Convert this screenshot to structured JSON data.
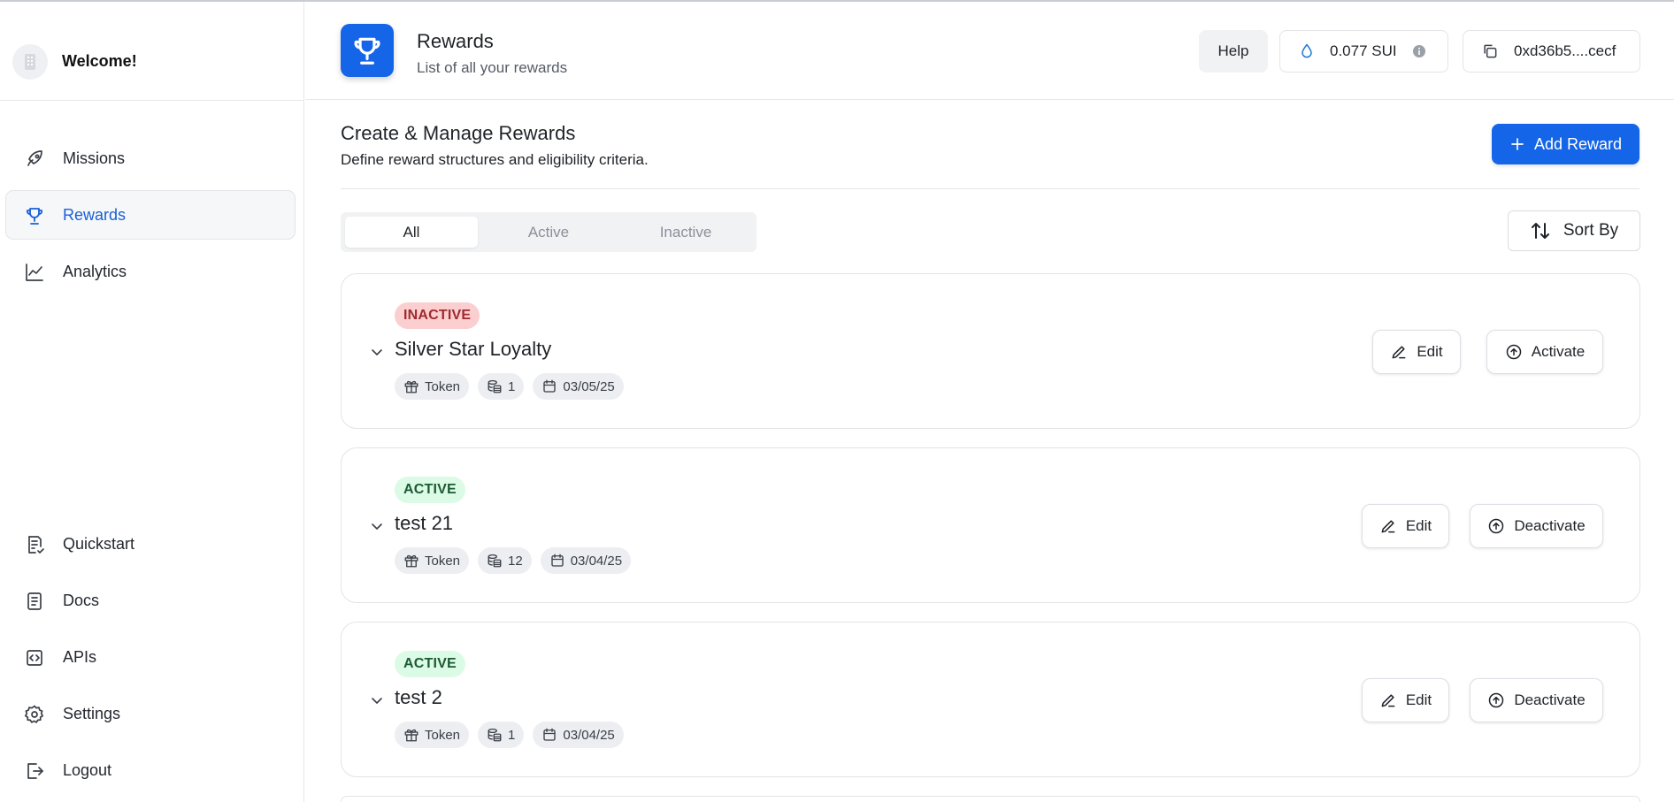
{
  "sidebar": {
    "brand_title": "Welcome!",
    "nav_top": [
      {
        "label": "Missions",
        "icon": "rocket-icon"
      },
      {
        "label": "Rewards",
        "icon": "trophy-icon",
        "active": true
      },
      {
        "label": "Analytics",
        "icon": "chart-line-icon"
      }
    ],
    "nav_bottom": [
      {
        "label": "Quickstart",
        "icon": "quickstart-icon"
      },
      {
        "label": "Docs",
        "icon": "docs-icon"
      },
      {
        "label": "APIs",
        "icon": "code-icon"
      },
      {
        "label": "Settings",
        "icon": "gear-icon"
      },
      {
        "label": "Logout",
        "icon": "logout-icon"
      }
    ]
  },
  "header": {
    "title": "Rewards",
    "subtitle": "List of all your rewards",
    "help_label": "Help",
    "balance": "0.077 SUI",
    "wallet": "0xd36b5....cecf"
  },
  "main": {
    "section_title": "Create & Manage Rewards",
    "section_subtitle": "Define reward structures and eligibility criteria.",
    "add_button": "Add Reward",
    "tabs": [
      {
        "label": "All",
        "selected": true
      },
      {
        "label": "Active"
      },
      {
        "label": "Inactive"
      }
    ],
    "sort_label": "Sort By",
    "rewards": [
      {
        "status": "INACTIVE",
        "name": "Silver Star Loyalty",
        "type": "Token",
        "count": "1",
        "date": "03/05/25",
        "edit": "Edit",
        "action": "Activate"
      },
      {
        "status": "ACTIVE",
        "name": "test 21",
        "type": "Token",
        "count": "12",
        "date": "03/04/25",
        "edit": "Edit",
        "action": "Deactivate"
      },
      {
        "status": "ACTIVE",
        "name": "test 2",
        "type": "Token",
        "count": "1",
        "date": "03/04/25",
        "edit": "Edit",
        "action": "Deactivate"
      }
    ]
  },
  "colors": {
    "accent": "#1565e8",
    "inactive_badge_bg": "#fbcfd0",
    "active_badge_bg": "#dcfbe6"
  }
}
